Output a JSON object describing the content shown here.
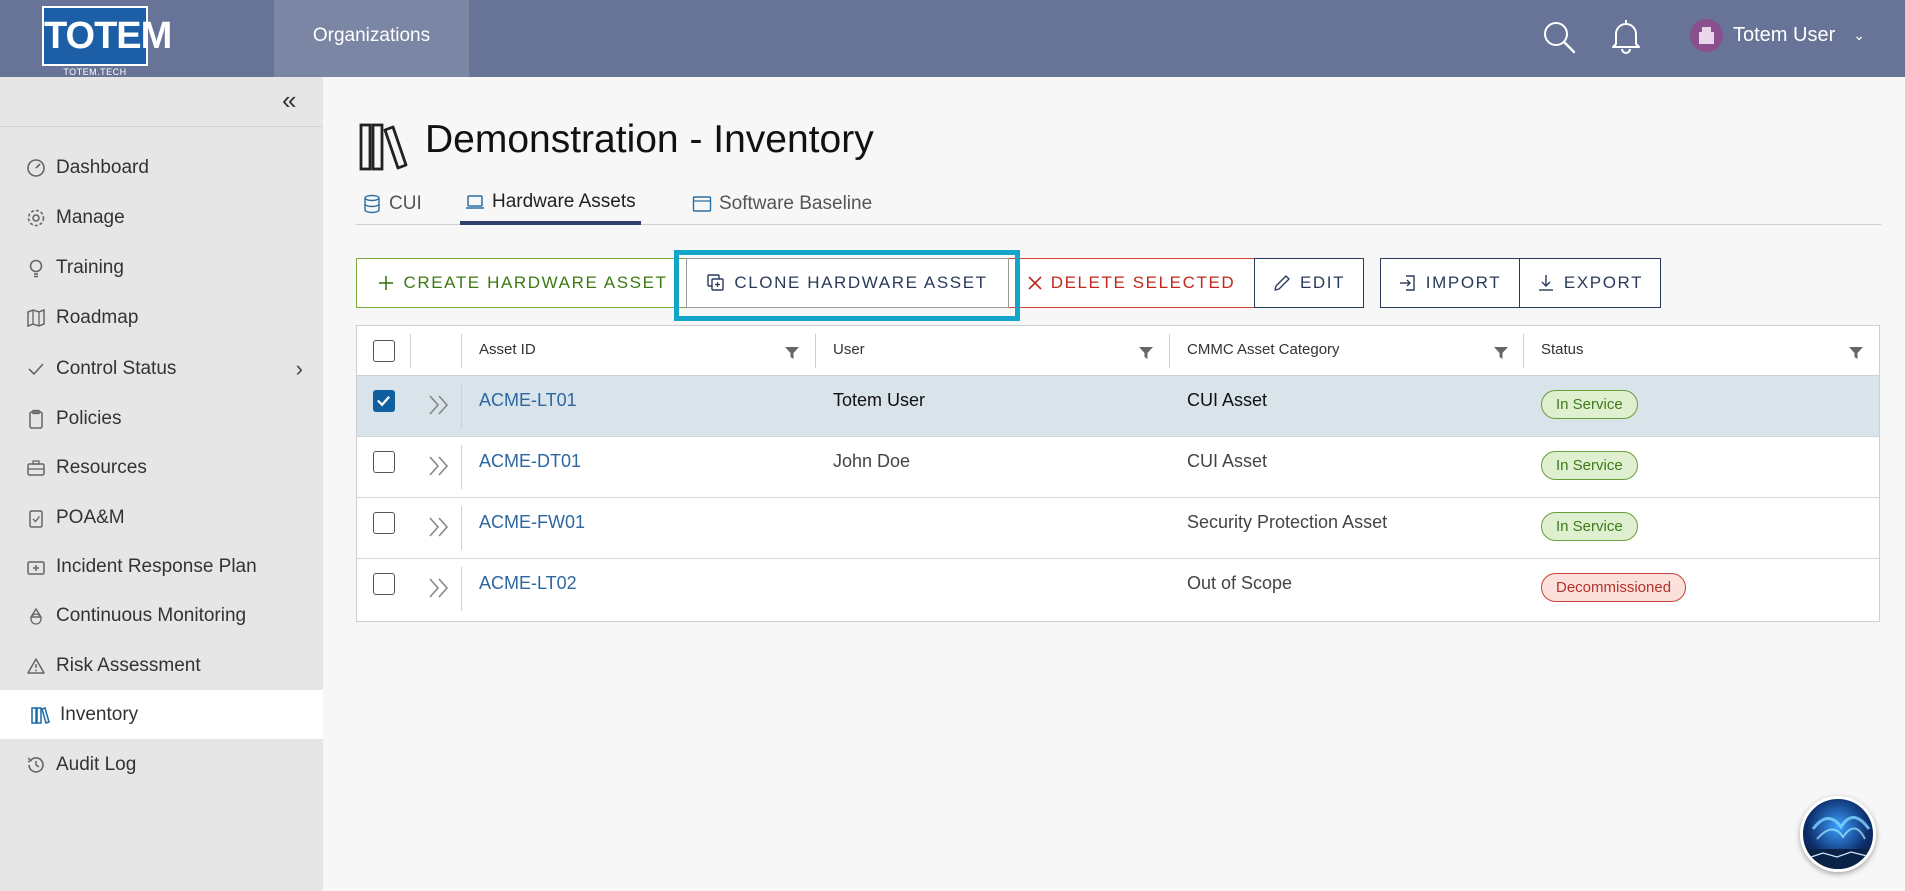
{
  "header": {
    "logo_text": "TOTEM",
    "logo_sub": "TOTEM.TECH",
    "nav_org": "Organizations",
    "user_name": "Totem User"
  },
  "sidebar": {
    "items": [
      {
        "label": "Dashboard",
        "icon": "gauge-icon"
      },
      {
        "label": "Manage",
        "icon": "gear-icon"
      },
      {
        "label": "Training",
        "icon": "lightbulb-icon"
      },
      {
        "label": "Roadmap",
        "icon": "map-icon"
      },
      {
        "label": "Control Status",
        "icon": "check-icon"
      },
      {
        "label": "Policies",
        "icon": "clipboard-icon"
      },
      {
        "label": "Resources",
        "icon": "toolbox-icon"
      },
      {
        "label": "POA&M",
        "icon": "clipboard-check-icon"
      },
      {
        "label": "Incident Response Plan",
        "icon": "first-aid-icon"
      },
      {
        "label": "Continuous Monitoring",
        "icon": "recycle-icon"
      },
      {
        "label": "Risk Assessment",
        "icon": "warning-icon"
      },
      {
        "label": "Inventory",
        "icon": "books-icon"
      },
      {
        "label": "Audit Log",
        "icon": "history-icon"
      }
    ]
  },
  "page": {
    "title": "Demonstration - Inventory",
    "tabs": [
      {
        "label": "CUI",
        "icon": "database-icon"
      },
      {
        "label": "Hardware Assets",
        "icon": "laptop-icon"
      },
      {
        "label": "Software Baseline",
        "icon": "window-icon"
      }
    ]
  },
  "toolbar": {
    "create": "CREATE HARDWARE ASSET",
    "clone": "CLONE HARDWARE ASSET",
    "delete": "DELETE SELECTED",
    "edit": "EDIT",
    "import": "IMPORT",
    "export": "EXPORT"
  },
  "table": {
    "columns": [
      "Asset ID",
      "User",
      "CMMC Asset Category",
      "Status"
    ],
    "rows": [
      {
        "asset_id": "ACME-LT01",
        "user": "Totem User",
        "category": "CUI Asset",
        "status": "In Service",
        "selected": true
      },
      {
        "asset_id": "ACME-DT01",
        "user": "John Doe",
        "category": "CUI Asset",
        "status": "In Service",
        "selected": false
      },
      {
        "asset_id": "ACME-FW01",
        "user": "",
        "category": "Security Protection Asset",
        "status": "In Service",
        "selected": false
      },
      {
        "asset_id": "ACME-LT02",
        "user": "",
        "category": "Out of Scope",
        "status": "Decommissioned",
        "selected": false
      }
    ]
  },
  "colors": {
    "header_bg": "#687497",
    "accent_highlight": "#13a4c9",
    "status_ok": "#3f7a1a",
    "status_bad": "#b43228"
  }
}
